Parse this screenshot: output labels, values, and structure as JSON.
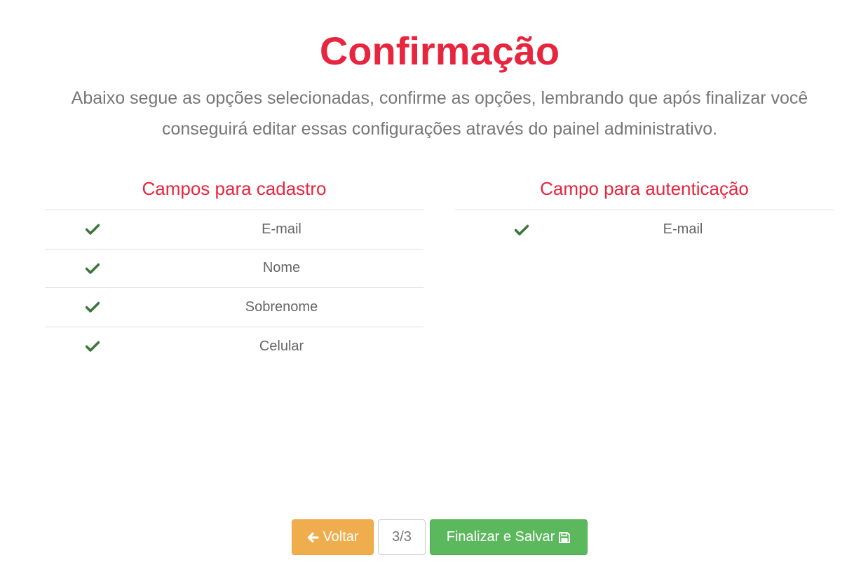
{
  "header": {
    "title": "Confirmação",
    "subtitle": "Abaixo segue as opções selecionadas, confirme as opções, lembrando que após finalizar você conseguirá editar essas configurações através do painel administrativo."
  },
  "registration_fields": {
    "heading": "Campos para cadastro",
    "items": [
      {
        "label": "E-mail"
      },
      {
        "label": "Nome"
      },
      {
        "label": "Sobrenome"
      },
      {
        "label": "Celular"
      }
    ]
  },
  "auth_fields": {
    "heading": "Campo para autenticação",
    "items": [
      {
        "label": "E-mail"
      }
    ]
  },
  "footer": {
    "back_label": "Voltar",
    "step": "3/3",
    "save_label": "Finalizar e Salvar",
    "back_icon": "arrow-left-icon",
    "save_icon": "floppy-disk-icon"
  },
  "colors": {
    "accent": "#e8253f",
    "check": "#3c763d",
    "back_button": "#f0ad4e",
    "save_button": "#5cb85c"
  }
}
